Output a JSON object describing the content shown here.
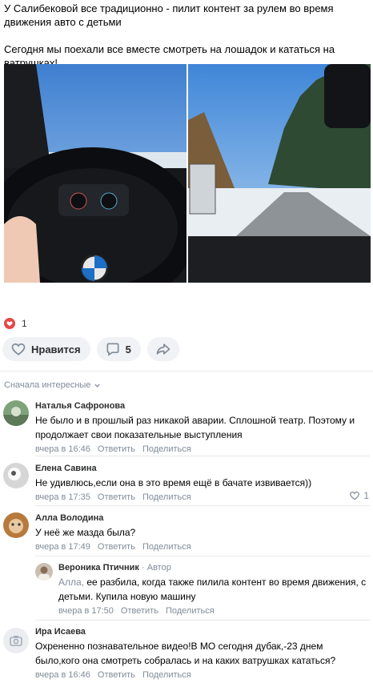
{
  "post": {
    "paragraphs": [
      "У Салибековой все традиционно - пилит контент за рулем во время движения авто с детьми",
      "Сегодня мы поехали все вместе смотреть на лошадок и кататься на ватрушках!"
    ]
  },
  "reactions": {
    "likes": "1"
  },
  "actions": {
    "like_label": "Нравится",
    "comments_count": "5"
  },
  "comments_header": {
    "sort_label": "Сначала интересные"
  },
  "comments": [
    {
      "name": "Наталья Сафронова",
      "text": "Не было и в прошлый раз никакой аварии. Сплошной театр. Поэтому и продолжает свои показательные выступления",
      "time": "вчера в 16:46",
      "reply": "Ответить",
      "share": "Поделиться"
    },
    {
      "name": "Елена Савина",
      "text": "Не удивлюсь,если она в это время ещё в бачате извивается))",
      "time": "вчера в 17:35",
      "reply": "Ответить",
      "share": "Поделиться",
      "likes": "1"
    },
    {
      "name": "Алла Володина",
      "text": "У неё же мазда была?",
      "time": "вчера в 17:49",
      "reply": "Ответить",
      "share": "Поделиться"
    },
    {
      "name": "Вероника Птичник",
      "role": " · Автор",
      "addressee": "Алла,",
      "text": " ее разбила, когда также пилила контент во время движения, с детьми. Купила новую машину",
      "time": "вчера в 17:50",
      "reply": "Ответить",
      "share": "Поделиться"
    },
    {
      "name": "Ира Исаева",
      "text": "Охрененно познавательное видео!В МО сегодня дубак,-23 днем было,кого она смотреть собралась и на каких ватрушках кататься?",
      "time": "вчера в 16:46",
      "reply": "Ответить",
      "share": "Поделиться"
    }
  ],
  "colors": {
    "accent": "#2688eb",
    "muted": "#818c99",
    "button_bg": "#f0f2f5",
    "like_red": "#e64646"
  }
}
